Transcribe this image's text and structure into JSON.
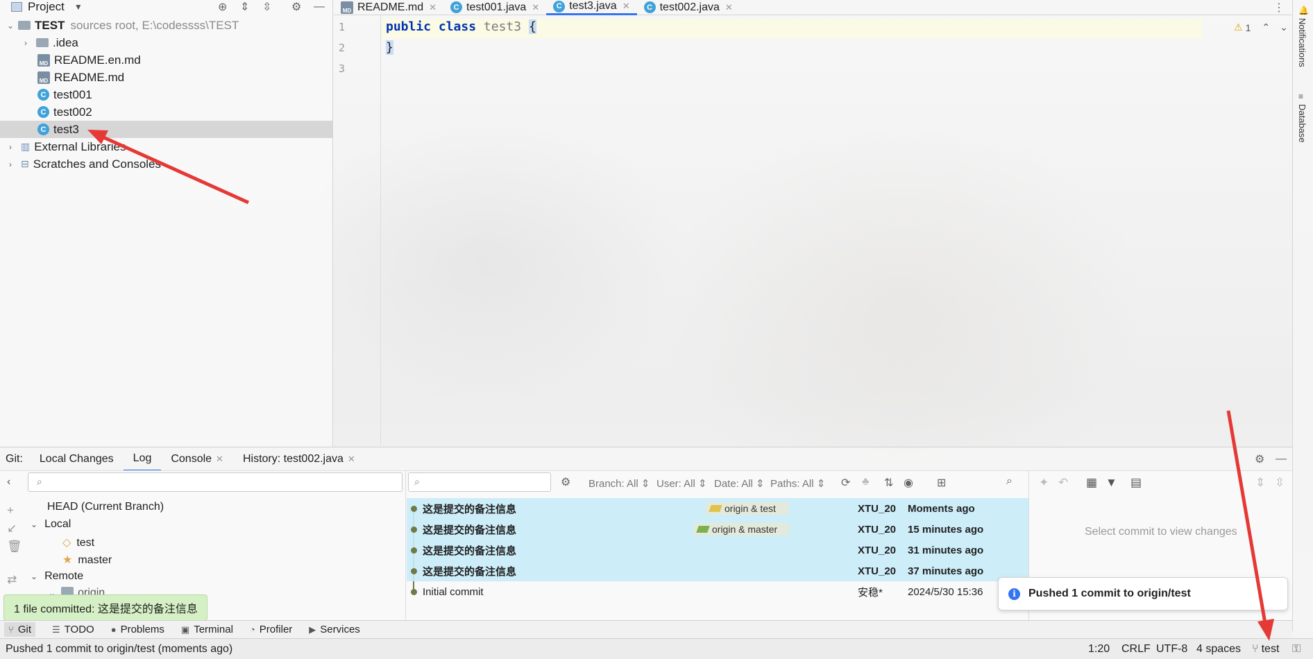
{
  "project": {
    "title": "Project",
    "root_name": "TEST",
    "root_hint": "sources root,  E:\\codessss\\TEST",
    "items": [
      {
        "label": ".idea",
        "kind": "folder"
      },
      {
        "label": "README.en.md",
        "kind": "md"
      },
      {
        "label": "README.md",
        "kind": "md"
      },
      {
        "label": "test001",
        "kind": "class"
      },
      {
        "label": "test002",
        "kind": "class"
      },
      {
        "label": "test3",
        "kind": "class"
      },
      {
        "label": "External Libraries",
        "kind": "lib"
      },
      {
        "label": "Scratches and Consoles",
        "kind": "scratch"
      }
    ]
  },
  "editor": {
    "tabs": [
      {
        "label": "README.md",
        "active": false
      },
      {
        "label": "test001.java",
        "active": false
      },
      {
        "label": "test3.java",
        "active": true
      },
      {
        "label": "test002.java",
        "active": false
      }
    ],
    "lines": [
      "1",
      "2",
      "3"
    ],
    "code": {
      "kw1": "public",
      "kw2": "class",
      "name": "test3",
      "open": "{",
      "close": "}"
    },
    "warning_count": "1"
  },
  "right_strip": {
    "notifications": "Notifications",
    "database": "Database"
  },
  "git": {
    "prefix": "Git:",
    "tabs": [
      "Local Changes",
      "Log",
      "Console",
      "History: test002.java"
    ],
    "branches": {
      "head": "HEAD (Current Branch)",
      "local": "Local",
      "local_items": [
        "test",
        "master"
      ],
      "remote": "Remote",
      "remote_items": [
        "origin"
      ]
    },
    "filters": {
      "branch": "Branch: All",
      "user": "User: All",
      "date": "Date: All",
      "paths": "Paths: All"
    },
    "commits": [
      {
        "msg": "这是提交的备注信息",
        "tag": "origin & test",
        "author": "XTU_20",
        "date": "Moments ago",
        "hl": true
      },
      {
        "msg": "这是提交的备注信息",
        "tag": "origin & master",
        "author": "XTU_20",
        "date": "15 minutes ago",
        "hl": true
      },
      {
        "msg": "这是提交的备注信息",
        "tag": "",
        "author": "XTU_20",
        "date": "31 minutes ago",
        "hl": true
      },
      {
        "msg": "这是提交的备注信息",
        "tag": "",
        "author": "XTU_20",
        "date": "37 minutes ago",
        "hl": true
      },
      {
        "msg": "Initial commit",
        "tag": "",
        "author": "安稳*",
        "date": "2024/5/30 15:36",
        "hl": false
      }
    ],
    "changes_placeholder": "Select commit to view changes"
  },
  "toasts": {
    "committed": "1 file committed: 这是提交的备注信息",
    "pushed": "Pushed 1 commit to origin/test"
  },
  "tools": [
    "Git",
    "TODO",
    "Problems",
    "Terminal",
    "Profiler",
    "Services"
  ],
  "status": {
    "message": "Pushed 1 commit to origin/test (moments ago)",
    "position": "1:20",
    "line_sep": "CRLF",
    "encoding": "UTF-8",
    "indent": "4 spaces",
    "branch": "test"
  },
  "colors": {
    "accent": "#3574f0",
    "highlight": "#c8ebf8",
    "annotation_arrow": "#e53935"
  }
}
